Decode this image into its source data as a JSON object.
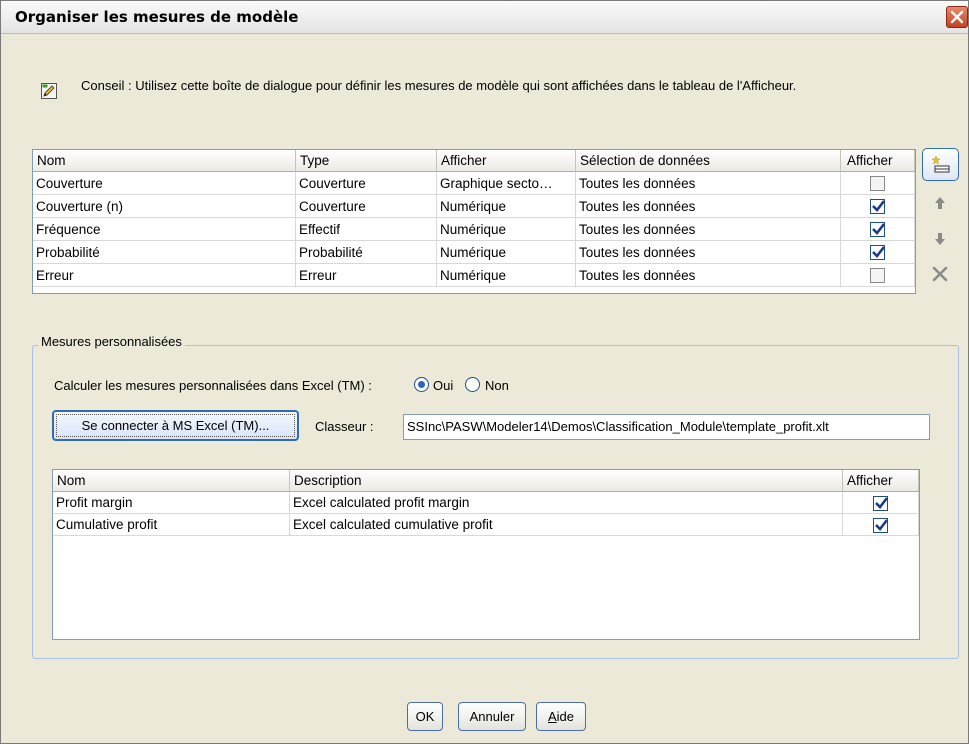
{
  "window": {
    "title": "Organiser les mesures de modèle"
  },
  "tip": {
    "text": "Conseil : Utilisez cette boîte de dialogue pour définir les mesures de modèle qui sont affichées dans le tableau de l'Afficheur."
  },
  "measures_table": {
    "headers": [
      "Nom",
      "Type",
      "Afficher",
      "Sélection de données",
      "Afficher"
    ],
    "rows": [
      {
        "nom": "Couverture",
        "type": "Couverture",
        "afficher": "Graphique secto…",
        "selection": "Toutes les données",
        "show": false
      },
      {
        "nom": "Couverture (n)",
        "type": "Couverture",
        "afficher": "Numérique",
        "selection": "Toutes les données",
        "show": true
      },
      {
        "nom": "Fréquence",
        "type": "Effectif",
        "afficher": "Numérique",
        "selection": "Toutes les données",
        "show": true
      },
      {
        "nom": "Probabilité",
        "type": "Probabilité",
        "afficher": "Numérique",
        "selection": "Toutes les données",
        "show": true
      },
      {
        "nom": "Erreur",
        "type": "Erreur",
        "afficher": "Numérique",
        "selection": "Toutes les données",
        "show": false
      }
    ]
  },
  "side_buttons": [
    "add-measure-icon",
    "move-up-icon",
    "move-down-icon",
    "delete-icon"
  ],
  "custom": {
    "group_label": "Mesures personnalisées",
    "calc_label": "Calculer les mesures personnalisées dans Excel (TM) :",
    "radio_yes": "Oui",
    "radio_no": "Non",
    "radio_selected": "Oui",
    "connect_button": "Se connecter à MS Excel (TM)...",
    "workbook_label": "Classeur :",
    "workbook_value": "SSInc\\PASW\\Modeler14\\Demos\\Classification_Module\\template_profit.xlt",
    "table": {
      "headers": [
        "Nom",
        "Description",
        "Afficher"
      ],
      "rows": [
        {
          "nom": "Profit margin",
          "description": "Excel calculated profit margin",
          "show": true
        },
        {
          "nom": "Cumulative profit",
          "description": "Excel calculated cumulative profit",
          "show": true
        }
      ]
    }
  },
  "buttons": {
    "ok": "OK",
    "cancel": "Annuler",
    "help_prefix": "",
    "help_mnemonic": "A",
    "help_rest": "ide"
  }
}
